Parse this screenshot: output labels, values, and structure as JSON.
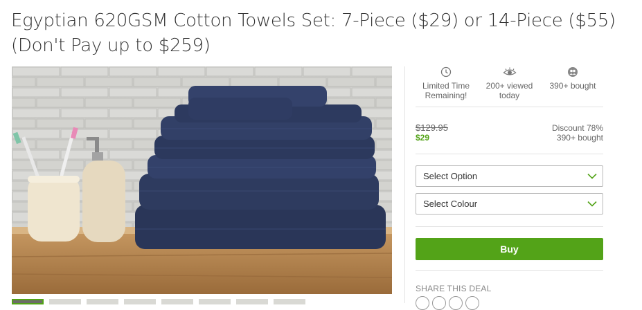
{
  "deal": {
    "title": "Egyptian 620GSM Cotton Towels Set: 7-Piece ($29) or 14-Piece ($55) (Don't Pay up to $259)"
  },
  "stats": [
    {
      "icon": "clock-icon",
      "label": "Limited Time\nRemaining!"
    },
    {
      "icon": "eye-icon",
      "label": "200+ viewed\ntoday"
    },
    {
      "icon": "people-icon",
      "label": "390+ bought"
    }
  ],
  "price": {
    "original": "$129.95",
    "sale": "$29",
    "discount": "Discount 78%",
    "bought": "390+ bought"
  },
  "options": {
    "option_placeholder": "Select Option",
    "colour_placeholder": "Select Colour"
  },
  "buy_label": "Buy",
  "share": {
    "label": "SHARE THIS DEAL",
    "icons": [
      "email-icon",
      "facebook-icon",
      "twitter-icon",
      "pinterest-icon"
    ]
  },
  "colors": {
    "accent": "#53a318",
    "towel": "#2c3a5e"
  }
}
